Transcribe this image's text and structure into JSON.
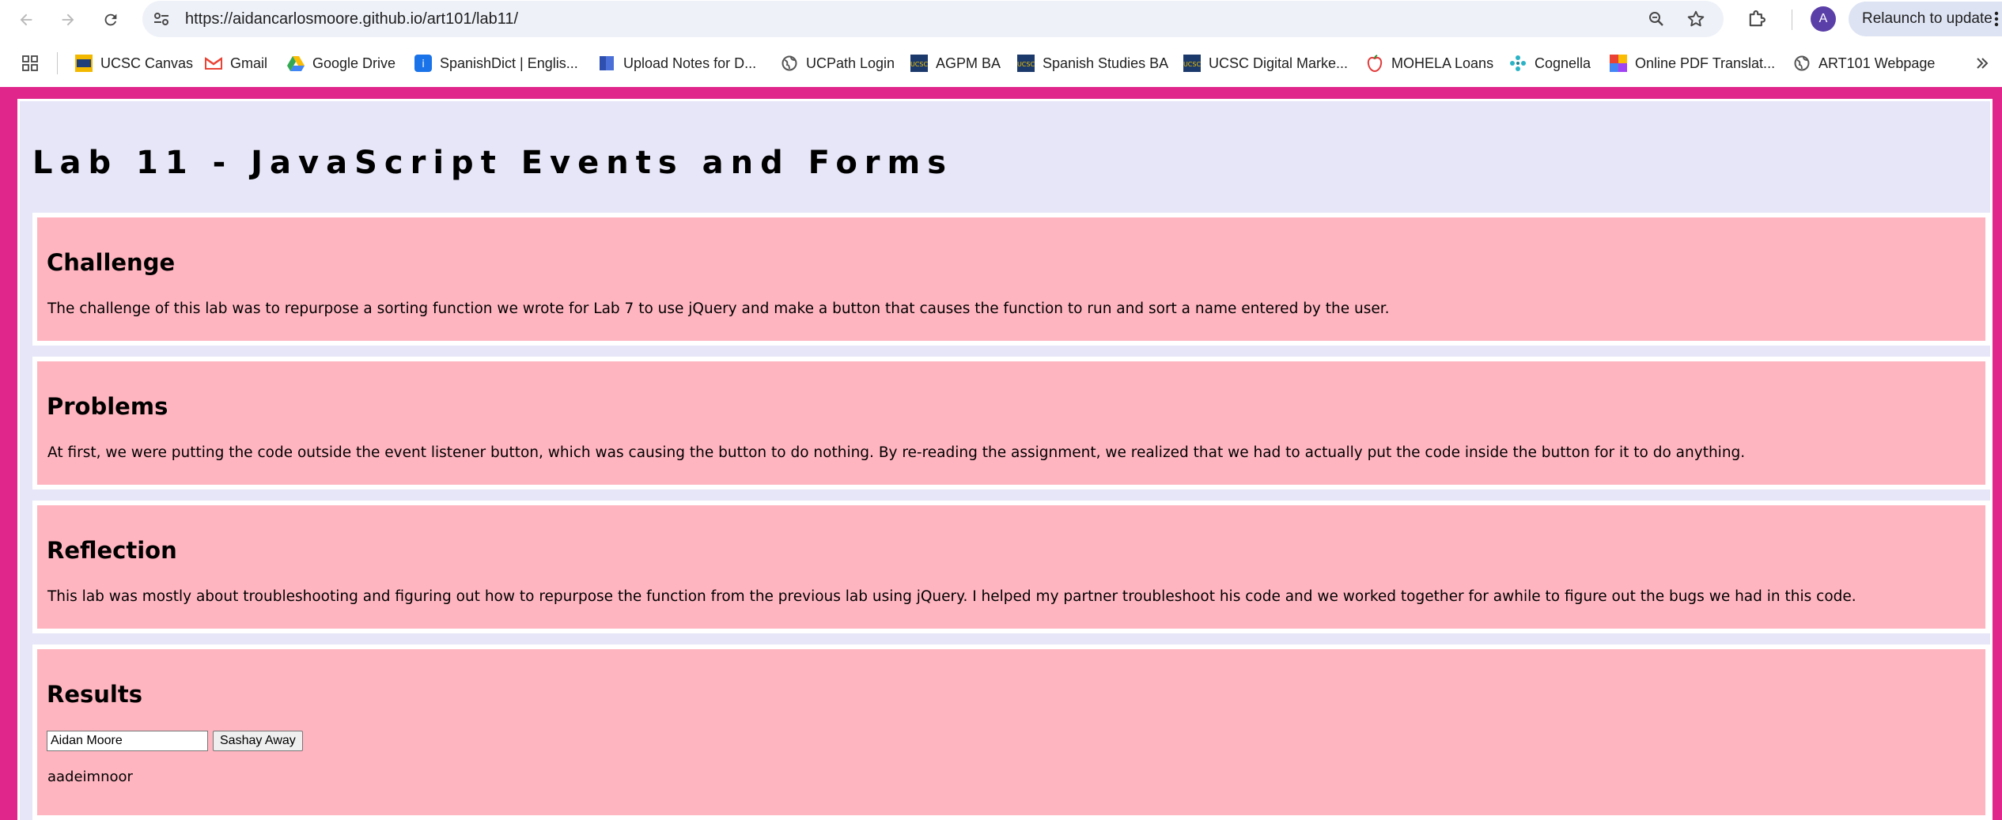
{
  "browser": {
    "url": "https://aidancarlosmoore.github.io/art101/lab11/",
    "avatar_letter": "A",
    "relaunch_label": "Relaunch to update",
    "bookmarks": [
      {
        "label": "UCSC Canvas",
        "icon": "ucsc-canvas-icon"
      },
      {
        "label": "Gmail",
        "icon": "gmail-icon"
      },
      {
        "label": "Google Drive",
        "icon": "google-drive-icon"
      },
      {
        "label": "SpanishDict | Englis...",
        "icon": "spanishdict-icon"
      },
      {
        "label": "Upload Notes for D...",
        "icon": "document-icon"
      },
      {
        "label": "UCPath Login",
        "icon": "globe-icon"
      },
      {
        "label": "AGPM BA",
        "icon": "ucsc-logo-icon"
      },
      {
        "label": "Spanish Studies BA",
        "icon": "ucsc-logo-icon"
      },
      {
        "label": "UCSC Digital Marke...",
        "icon": "ucsc-logo-icon"
      },
      {
        "label": "MOHELA Loans",
        "icon": "mohela-icon"
      },
      {
        "label": "Cognella",
        "icon": "cognella-icon"
      },
      {
        "label": "Online PDF Translat...",
        "icon": "pdf-translate-icon"
      },
      {
        "label": "ART101 Webpage",
        "icon": "globe-icon"
      }
    ]
  },
  "page": {
    "title": "Lab 11 - JavaScript Events and Forms",
    "sections": {
      "challenge": {
        "heading": "Challenge",
        "text": "The challenge of this lab was to repurpose a sorting function we wrote for Lab 7 to use jQuery and make a button that causes the function to run and sort a name entered by the user."
      },
      "problems": {
        "heading": "Problems",
        "text": "At first, we were putting the code outside the event listener button, which was causing the button to do nothing. By re-reading the assignment, we realized that we had to actually put the code inside the button for it to do anything."
      },
      "reflection": {
        "heading": "Reflection",
        "text": "This lab was mostly about troubleshooting and figuring out how to repurpose the function from the previous lab using jQuery. I helped my partner troubleshoot his code and we worked together for awhile to figure out the bugs we had in this code."
      },
      "results": {
        "heading": "Results",
        "input_value": "Aidan Moore",
        "button_label": "Sashay Away",
        "output": "aadeimnoor"
      }
    }
  },
  "colors": {
    "page_border": "#e0268a",
    "container_bg": "#e6e6f8",
    "section_bg": "#ffb5c0"
  }
}
